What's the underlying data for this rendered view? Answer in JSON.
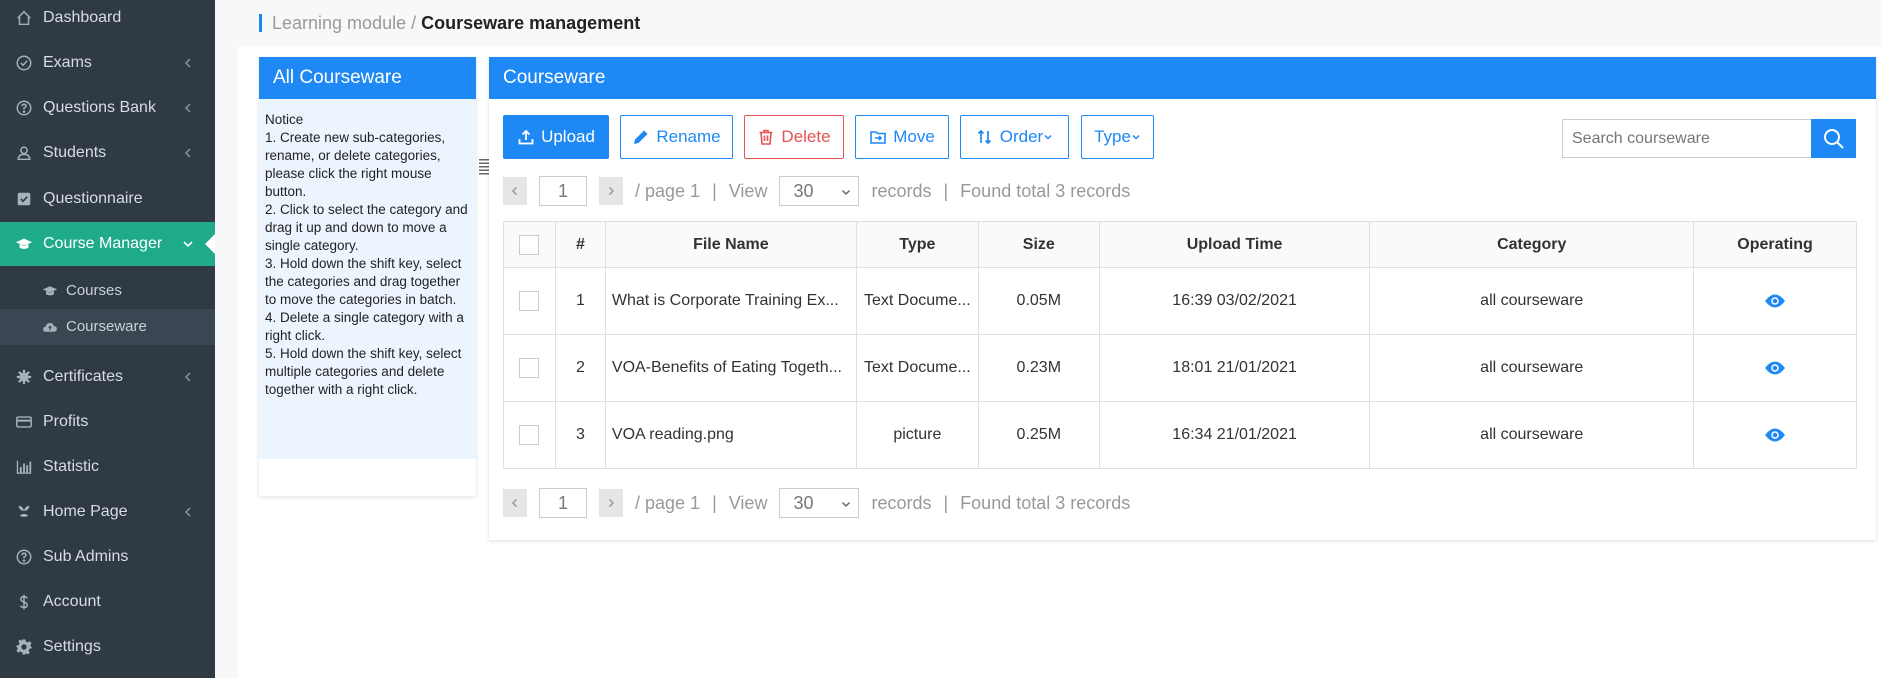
{
  "sidebar": {
    "items": [
      {
        "label": "Dashboard",
        "icon": "home-icon"
      },
      {
        "label": "Exams",
        "icon": "check-circle-icon"
      },
      {
        "label": "Questions Bank",
        "icon": "question-circle-icon"
      },
      {
        "label": "Students",
        "icon": "user-icon"
      },
      {
        "label": "Questionnaire",
        "icon": "checkbox-icon"
      },
      {
        "label": "Course Manager",
        "icon": "graduation-cap-icon"
      },
      {
        "label": "Certificates",
        "icon": "gear-seal-icon"
      },
      {
        "label": "Profits",
        "icon": "credit-card-icon"
      },
      {
        "label": "Statistic",
        "icon": "bar-chart-icon"
      },
      {
        "label": "Home Page",
        "icon": "leaf-icon"
      },
      {
        "label": "Sub Admins",
        "icon": "question-circle-icon"
      },
      {
        "label": "Account",
        "icon": "dollar-icon"
      },
      {
        "label": "Settings",
        "icon": "gear-icon"
      }
    ],
    "sub_items": [
      {
        "label": "Courses",
        "icon": "graduation-cap-icon"
      },
      {
        "label": "Courseware",
        "icon": "cloud-icon"
      }
    ],
    "active_color": "#1fab89",
    "bg_color": "#2f3a45"
  },
  "breadcrumb": {
    "parent": "Learning module",
    "separator": " / ",
    "current": "Courseware management"
  },
  "left_panel": {
    "title": "All Courseware",
    "notice_title": "Notice",
    "notice_lines": [
      "1. Create new sub-categories, rename, or delete categories, please click the right mouse button.",
      "2. Click to select the category and drag it up and down to move a single category.",
      "3. Hold down the shift key, select the categories and drag together to move the categories in batch.",
      "4. Delete a single category with a right click.",
      "5. Hold down the shift key, select multiple categories and delete together with a right click."
    ]
  },
  "main_panel": {
    "title": "Courseware",
    "toolbar": {
      "upload": "Upload",
      "rename": "Rename",
      "delete": "Delete",
      "move": "Move",
      "order": "Order",
      "type": "Type"
    },
    "search": {
      "placeholder": "Search courseware"
    },
    "pager": {
      "page": "1",
      "page_text": "/ page 1",
      "view": "View",
      "per_page": "30",
      "records": "records",
      "found": "Found total 3 records",
      "divider": "|"
    },
    "table": {
      "headers": [
        "#",
        "File Name",
        "Type",
        "Size",
        "Upload Time",
        "Category",
        "Operating"
      ],
      "rows": [
        {
          "num": "1",
          "name": "What is Corporate Training Ex...",
          "type": "Text Docume...",
          "size": "0.05M",
          "time": "16:39 03/02/2021",
          "category": "all courseware"
        },
        {
          "num": "2",
          "name": "VOA-Benefits of Eating Togeth...",
          "type": "Text Docume...",
          "size": "0.23M",
          "time": "18:01 21/01/2021",
          "category": "all courseware"
        },
        {
          "num": "3",
          "name": "VOA reading.png",
          "type": "picture",
          "size": "0.25M",
          "time": "16:34 21/01/2021",
          "category": "all courseware"
        }
      ]
    }
  },
  "colors": {
    "primary": "#1e88f5",
    "danger": "#e55353"
  }
}
